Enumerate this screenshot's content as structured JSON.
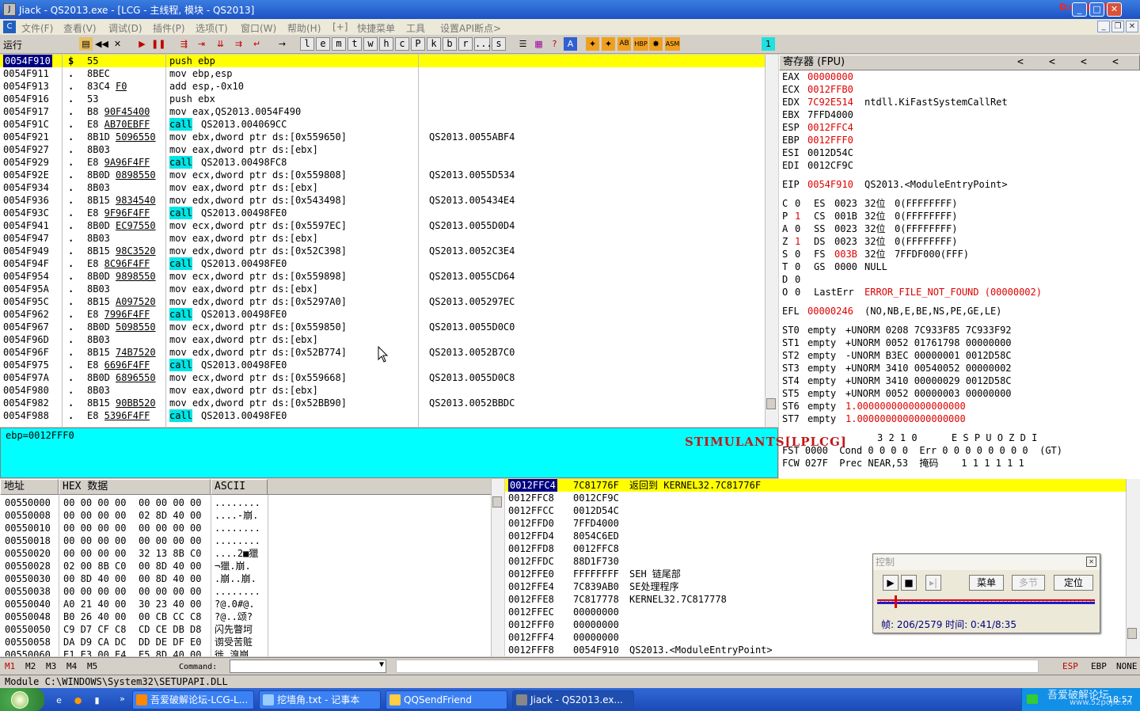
{
  "window": {
    "title": "Jiack  - QS2013.exe - [LCG - 主线程, 模块 - QS2013]",
    "clock": "0:41/8:35"
  },
  "menu": [
    "文件(F)",
    "查看(V)",
    "调试(D)",
    "插件(P)",
    "选项(T)",
    "窗口(W)",
    "帮助(H)",
    "[+]",
    "快捷菜单",
    "工具",
    "设置API断点>"
  ],
  "toolbar": {
    "status": "运行",
    "letters": [
      "l",
      "e",
      "m",
      "t",
      "w",
      "h",
      "c",
      "P",
      "k",
      "b",
      "r",
      "...",
      "s"
    ]
  },
  "disasm": {
    "rows": [
      {
        "addr": "0054F910",
        "m": "$",
        "hex": "55",
        "asm": "push ebp",
        "cmt": ""
      },
      {
        "addr": "0054F911",
        "m": ".",
        "hex": "8BEC",
        "asm": "mov ebp,esp",
        "cmt": ""
      },
      {
        "addr": "0054F913",
        "m": ".",
        "hex": "83C4 F0",
        "asm": "add esp,-0x10",
        "cmt": ""
      },
      {
        "addr": "0054F916",
        "m": ".",
        "hex": "53",
        "asm": "push ebx",
        "cmt": ""
      },
      {
        "addr": "0054F917",
        "m": ".",
        "hex": "B8 90F45400",
        "asm": "mov eax,QS2013.0054F490",
        "cmt": ""
      },
      {
        "addr": "0054F91C",
        "m": ".",
        "hex": "E8 AB70EBFF",
        "asm": "call QS2013.004069CC",
        "cmt": ""
      },
      {
        "addr": "0054F921",
        "m": ".",
        "hex": "8B1D 5096550",
        "asm": "mov ebx,dword ptr ds:[0x559650]",
        "cmt": "QS2013.0055ABF4"
      },
      {
        "addr": "0054F927",
        "m": ".",
        "hex": "8B03",
        "asm": "mov eax,dword ptr ds:[ebx]",
        "cmt": ""
      },
      {
        "addr": "0054F929",
        "m": ".",
        "hex": "E8 9A96F4FF",
        "asm": "call QS2013.00498FC8",
        "cmt": ""
      },
      {
        "addr": "0054F92E",
        "m": ".",
        "hex": "8B0D 0898550",
        "asm": "mov ecx,dword ptr ds:[0x559808]",
        "cmt": "QS2013.0055D534"
      },
      {
        "addr": "0054F934",
        "m": ".",
        "hex": "8B03",
        "asm": "mov eax,dword ptr ds:[ebx]",
        "cmt": ""
      },
      {
        "addr": "0054F936",
        "m": ".",
        "hex": "8B15 9834540",
        "asm": "mov edx,dword ptr ds:[0x543498]",
        "cmt": "QS2013.005434E4"
      },
      {
        "addr": "0054F93C",
        "m": ".",
        "hex": "E8 9F96F4FF",
        "asm": "call QS2013.00498FE0",
        "cmt": ""
      },
      {
        "addr": "0054F941",
        "m": ".",
        "hex": "8B0D EC97550",
        "asm": "mov ecx,dword ptr ds:[0x5597EC]",
        "cmt": "QS2013.0055D0D4"
      },
      {
        "addr": "0054F947",
        "m": ".",
        "hex": "8B03",
        "asm": "mov eax,dword ptr ds:[ebx]",
        "cmt": ""
      },
      {
        "addr": "0054F949",
        "m": ".",
        "hex": "8B15 98C3520",
        "asm": "mov edx,dword ptr ds:[0x52C398]",
        "cmt": "QS2013.0052C3E4"
      },
      {
        "addr": "0054F94F",
        "m": ".",
        "hex": "E8 8C96F4FF",
        "asm": "call QS2013.00498FE0",
        "cmt": ""
      },
      {
        "addr": "0054F954",
        "m": ".",
        "hex": "8B0D 9898550",
        "asm": "mov ecx,dword ptr ds:[0x559898]",
        "cmt": "QS2013.0055CD64"
      },
      {
        "addr": "0054F95A",
        "m": ".",
        "hex": "8B03",
        "asm": "mov eax,dword ptr ds:[ebx]",
        "cmt": ""
      },
      {
        "addr": "0054F95C",
        "m": ".",
        "hex": "8B15 A097520",
        "asm": "mov edx,dword ptr ds:[0x5297A0]",
        "cmt": "QS2013.005297EC"
      },
      {
        "addr": "0054F962",
        "m": ".",
        "hex": "E8 7996F4FF",
        "asm": "call QS2013.00498FE0",
        "cmt": ""
      },
      {
        "addr": "0054F967",
        "m": ".",
        "hex": "8B0D 5098550",
        "asm": "mov ecx,dword ptr ds:[0x559850]",
        "cmt": "QS2013.0055D0C0"
      },
      {
        "addr": "0054F96D",
        "m": ".",
        "hex": "8B03",
        "asm": "mov eax,dword ptr ds:[ebx]",
        "cmt": ""
      },
      {
        "addr": "0054F96F",
        "m": ".",
        "hex": "8B15 74B7520",
        "asm": "mov edx,dword ptr ds:[0x52B774]",
        "cmt": "QS2013.0052B7C0"
      },
      {
        "addr": "0054F975",
        "m": ".",
        "hex": "E8 6696F4FF",
        "asm": "call QS2013.00498FE0",
        "cmt": ""
      },
      {
        "addr": "0054F97A",
        "m": ".",
        "hex": "8B0D 6896550",
        "asm": "mov ecx,dword ptr ds:[0x559668]",
        "cmt": "QS2013.0055D0C8"
      },
      {
        "addr": "0054F980",
        "m": ".",
        "hex": "8B03",
        "asm": "mov eax,dword ptr ds:[ebx]",
        "cmt": ""
      },
      {
        "addr": "0054F982",
        "m": ".",
        "hex": "8B15 90BB520",
        "asm": "mov edx,dword ptr ds:[0x52BB90]",
        "cmt": "QS2013.0052BBDC"
      },
      {
        "addr": "0054F988",
        "m": ".",
        "hex": "E8 5396F4FF",
        "asm": "call QS2013.00498FE0",
        "cmt": ""
      }
    ]
  },
  "info": {
    "text": "ebp=0012FFF0",
    "watermark": "STIMULANTS[LPLCG]"
  },
  "registers": {
    "header": "寄存器 (FPU)",
    "nav": [
      "<",
      "<",
      "<",
      "<"
    ],
    "lines": [
      {
        "n": "EAX",
        "v": "00000000",
        "c": "",
        "red": true
      },
      {
        "n": "ECX",
        "v": "0012FFB0",
        "c": "",
        "red": true
      },
      {
        "n": "EDX",
        "v": "7C92E514",
        "c": "ntdll.KiFastSystemCallRet",
        "red": true
      },
      {
        "n": "EBX",
        "v": "7FFD4000",
        "c": "",
        "red": false
      },
      {
        "n": "ESP",
        "v": "0012FFC4",
        "c": "",
        "red": true
      },
      {
        "n": "EBP",
        "v": "0012FFF0",
        "c": "",
        "red": true
      },
      {
        "n": "ESI",
        "v": "0012D54C",
        "c": "",
        "red": false
      },
      {
        "n": "EDI",
        "v": "0012CF9C",
        "c": "",
        "red": false
      },
      {
        "n": "",
        "v": "",
        "c": "",
        "red": false
      },
      {
        "n": "EIP",
        "v": "0054F910",
        "c": "QS2013.<ModuleEntryPoint>",
        "red": true
      }
    ],
    "flags": [
      {
        "f": "C",
        "v": "0",
        "s": "ES",
        "sv": "0023",
        "b": "32位",
        "l": "0(FFFFFFFF)",
        "red": false
      },
      {
        "f": "P",
        "v": "1",
        "s": "CS",
        "sv": "001B",
        "b": "32位",
        "l": "0(FFFFFFFF)",
        "red": true
      },
      {
        "f": "A",
        "v": "0",
        "s": "SS",
        "sv": "0023",
        "b": "32位",
        "l": "0(FFFFFFFF)",
        "red": false
      },
      {
        "f": "Z",
        "v": "1",
        "s": "DS",
        "sv": "0023",
        "b": "32位",
        "l": "0(FFFFFFFF)",
        "red": true
      },
      {
        "f": "S",
        "v": "0",
        "s": "FS",
        "sv": "003B",
        "b": "32位",
        "l": "7FFDF000(FFF)",
        "red": false
      },
      {
        "f": "T",
        "v": "0",
        "s": "GS",
        "sv": "0000",
        "b": "NULL",
        "l": "",
        "red": false
      },
      {
        "f": "D",
        "v": "0",
        "s": "",
        "sv": "",
        "b": "",
        "l": "",
        "red": false
      },
      {
        "f": "O",
        "v": "0",
        "s": "LastErr",
        "sv": "ERROR_FILE_NOT_FOUND (00000002)",
        "b": "",
        "l": "",
        "red": false
      }
    ],
    "efl": {
      "n": "EFL",
      "v": "00000246",
      "c": "(NO,NB,E,BE,NS,PE,GE,LE)"
    },
    "st": [
      {
        "n": "ST0",
        "t": "empty",
        "v": "+UNORM 0208 7C933F85 7C933F92",
        "red": false
      },
      {
        "n": "ST1",
        "t": "empty",
        "v": "+UNORM 0052 01761798 00000000",
        "red": false
      },
      {
        "n": "ST2",
        "t": "empty",
        "v": "-UNORM B3EC 00000001 0012D58C",
        "red": false
      },
      {
        "n": "ST3",
        "t": "empty",
        "v": "+UNORM 3410 00540052 00000002",
        "red": false
      },
      {
        "n": "ST4",
        "t": "empty",
        "v": "+UNORM 3410 00000029 0012D58C",
        "red": false
      },
      {
        "n": "ST5",
        "t": "empty",
        "v": "+UNORM 0052 00000003 00000000",
        "red": false
      },
      {
        "n": "ST6",
        "t": "empty",
        "v": "1.0000000000000000000",
        "red": true
      },
      {
        "n": "ST7",
        "t": "empty",
        "v": "1.0000000000000000000",
        "red": true
      }
    ],
    "fpu_hdr": "3 2 1 0      E S P U O Z D I",
    "fst": "FST 0000  Cond 0 0 0 0  Err 0 0 0 0 0 0 0 0  (GT)",
    "fcw": "FCW 027F  Prec NEAR,53  掩码    1 1 1 1 1 1"
  },
  "dump": {
    "headers": [
      "地址",
      "HEX 数据",
      "ASCII"
    ],
    "rows": [
      {
        "a": "00550000",
        "h1": "00 00 00 00",
        "h2": "00 00 00 00",
        "s": "........"
      },
      {
        "a": "00550008",
        "h1": "00 00 00 00",
        "h2": "02 8D 40 00",
        "s": "....-崩."
      },
      {
        "a": "00550010",
        "h1": "00 00 00 00",
        "h2": "00 00 00 00",
        "s": "........"
      },
      {
        "a": "00550018",
        "h1": "00 00 00 00",
        "h2": "00 00 00 00",
        "s": "........"
      },
      {
        "a": "00550020",
        "h1": "00 00 00 00",
        "h2": "32 13 8B C0",
        "s": "....2■獵"
      },
      {
        "a": "00550028",
        "h1": "02 00 8B C0",
        "h2": "00 8D 40 00",
        "s": "¬獵.崩."
      },
      {
        "a": "00550030",
        "h1": "00 8D 40 00",
        "h2": "00 8D 40 00",
        "s": ".崩..崩."
      },
      {
        "a": "00550038",
        "h1": "00 00 00 00",
        "h2": "00 00 00 00",
        "s": "........"
      },
      {
        "a": "00550040",
        "h1": "A0 21 40 00",
        "h2": "30 23 40 00",
        "s": "?@.0#@."
      },
      {
        "a": "00550048",
        "h1": "B0 26 40 00",
        "h2": "00 CB CC C8",
        "s": "?@..颂?"
      },
      {
        "a": "00550050",
        "h1": "C9 D7 CF C8",
        "h2": "CD CE DB D8",
        "s": "闪先瞥坷"
      },
      {
        "a": "00550058",
        "h1": "DA D9 CA DC",
        "h2": "DD DE DF E0",
        "s": "谫受苦赃"
      },
      {
        "a": "00550060",
        "h1": "E1 E3 00 E4",
        "h2": "E5 8D 40 00",
        "s": "徙.溴崩."
      }
    ]
  },
  "stack": {
    "rows": [
      {
        "a": "0012FFC4",
        "v": "7C81776F",
        "c": "返回到 KERNEL32.7C81776F",
        "sel": true
      },
      {
        "a": "0012FFC8",
        "v": "0012CF9C",
        "c": "",
        "sel": false
      },
      {
        "a": "0012FFCC",
        "v": "0012D54C",
        "c": "",
        "sel": false
      },
      {
        "a": "0012FFD0",
        "v": "7FFD4000",
        "c": "",
        "sel": false
      },
      {
        "a": "0012FFD4",
        "v": "8054C6ED",
        "c": "",
        "sel": false
      },
      {
        "a": "0012FFD8",
        "v": "0012FFC8",
        "c": "",
        "sel": false
      },
      {
        "a": "0012FFDC",
        "v": "88D1F730",
        "c": "",
        "sel": false
      },
      {
        "a": "0012FFE0",
        "v": "FFFFFFFF",
        "c": "SEH 链尾部",
        "sel": false
      },
      {
        "a": "0012FFE4",
        "v": "7C839AB0",
        "c": "SE处理程序",
        "sel": false
      },
      {
        "a": "0012FFE8",
        "v": "7C817778",
        "c": "KERNEL32.7C817778",
        "sel": false
      },
      {
        "a": "0012FFEC",
        "v": "00000000",
        "c": "",
        "sel": false
      },
      {
        "a": "0012FFF0",
        "v": "00000000",
        "c": "",
        "sel": false
      },
      {
        "a": "0012FFF4",
        "v": "00000000",
        "c": "",
        "sel": false
      },
      {
        "a": "0012FFF8",
        "v": "0054F910",
        "c": "QS2013.<ModuleEntryPoint>",
        "sel": false
      }
    ]
  },
  "control": {
    "title": "控制",
    "menu": "菜单",
    "section": "多节",
    "locate": "定位",
    "progress": 0.08,
    "info": "帧: 206/2579 时间: 0:41/8:35"
  },
  "bottom": {
    "marks": [
      "M1",
      "M2",
      "M3",
      "M4",
      "M5"
    ],
    "command": "Command:",
    "reg_modes": [
      "ESP",
      "EBP",
      "NONE"
    ]
  },
  "status": "Module C:\\WINDOWS\\System32\\SETUPAPI.DLL",
  "taskbar": {
    "tasks": [
      {
        "label": "吾爱破解论坛-LCG-L..."
      },
      {
        "label": "挖墙角.txt - 记事本"
      },
      {
        "label": "QQSendFriend"
      },
      {
        "label": "Jiack  - QS2013.ex..."
      }
    ],
    "tray_text": "吾爱破解论坛",
    "tray_url": "www.52pojie.cn",
    "time": "18:57"
  }
}
